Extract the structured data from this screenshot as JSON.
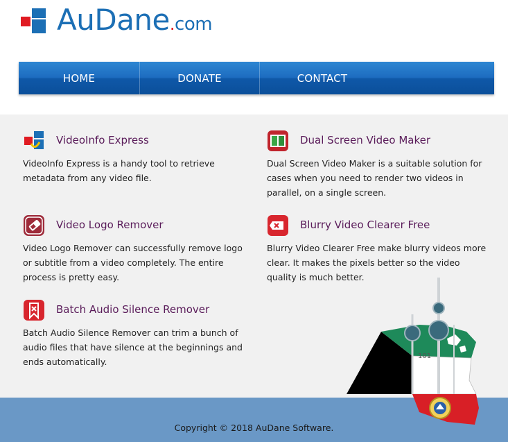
{
  "brand": {
    "name_main": "AuDane",
    "name_dot": ".",
    "name_tld": "com"
  },
  "nav": {
    "items": [
      {
        "label": "HOME"
      },
      {
        "label": "DONATE"
      },
      {
        "label": "CONTACT"
      }
    ]
  },
  "products": [
    {
      "icon": "videoinfo-icon",
      "title": "VideoInfo Express",
      "description": "VideoInfo Express is a handy tool to retrieve metadata from any video file."
    },
    {
      "icon": "dual-screen-icon",
      "title": "Dual Screen Video Maker",
      "description": "Dual Screen Video Maker is a suitable solution for cases when you need to render two videos in parallel, on a single screen."
    },
    {
      "icon": "logo-remover-icon",
      "title": "Video Logo Remover",
      "description": "Video Logo Remover can successfully remove logo or subtitle from a video completely. The entire process is pretty easy."
    },
    {
      "icon": "blurry-clearer-icon",
      "title": "Blurry Video Clearer Free",
      "description": "Blurry Video Clearer Free make blurry videos more clear. It makes the pixels better so the video quality is much better."
    },
    {
      "icon": "audio-silence-icon",
      "title": "Batch Audio Silence Remover",
      "description": "Batch Audio Silence Remover can trim a bunch of audio files that have silence at the beginnings and ends automatically."
    }
  ],
  "map_label": "101",
  "footer": {
    "copyright": "Copyright © 2018 AuDane Software."
  },
  "colors": {
    "brand_blue": "#1c6fb5",
    "brand_red": "#e01b22",
    "title_purple": "#5a1c5a",
    "footer_blue": "#6a98c6"
  }
}
